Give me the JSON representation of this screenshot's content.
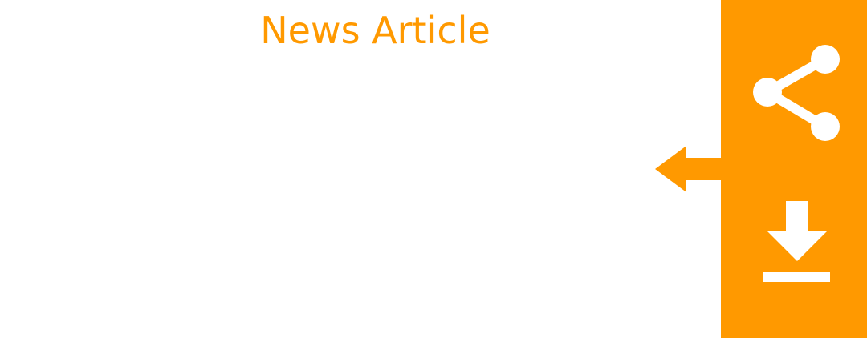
{
  "header": {
    "title": "News Article"
  },
  "actions": {
    "share_icon": "share-icon",
    "download_icon": "download-icon",
    "pointer_icon": "arrow-left-icon"
  },
  "colors": {
    "accent": "#ff9900",
    "background": "#ffffff",
    "icon": "#ffffff"
  }
}
